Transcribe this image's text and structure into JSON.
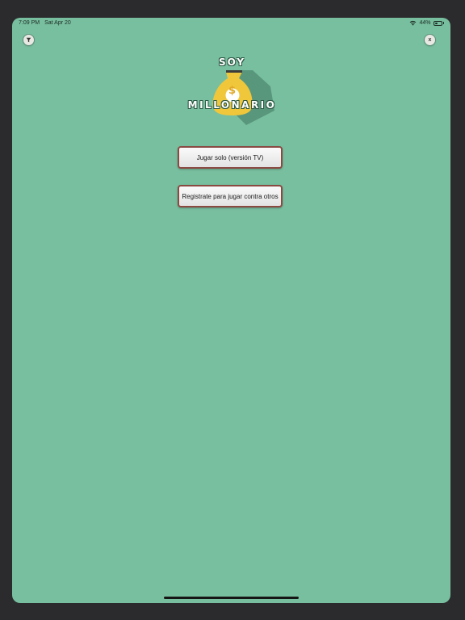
{
  "status_bar": {
    "time": "7:09 PM",
    "date": "Sat Apr 20",
    "battery_percent": "44%",
    "battery_level": 0.44
  },
  "header": {
    "filter_icon": "funnel-icon",
    "close_label": "x"
  },
  "logo": {
    "top_word": "SOY",
    "bottom_word": "MILLONARIO",
    "icon": "money-bag-icon",
    "symbol": "$"
  },
  "menu": {
    "play_solo_label": "Jugar solo (versión TV)",
    "register_label": "Registrate para jugar contra otros"
  },
  "colors": {
    "background": "#78bf9f",
    "button_border": "#8a4a42",
    "bag_gold": "#f0c63a"
  }
}
